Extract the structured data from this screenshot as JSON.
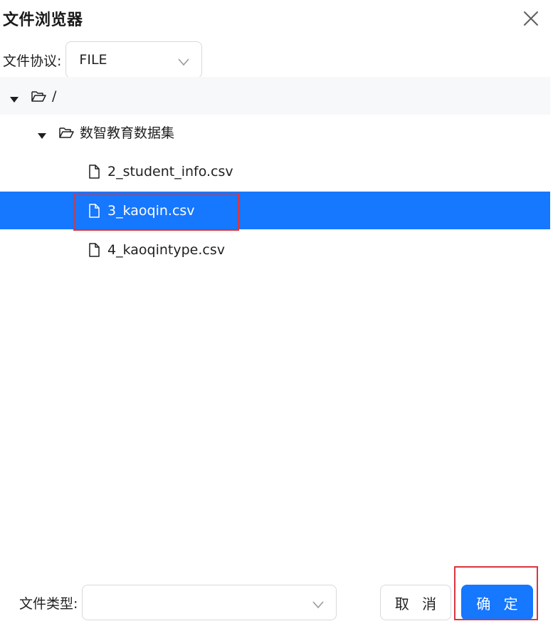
{
  "dialog": {
    "title": "文件浏览器"
  },
  "protocol": {
    "label": "文件协议",
    "value": "FILE"
  },
  "tree": {
    "root": {
      "label": "/"
    },
    "folder": {
      "label": "数智教育数据集"
    },
    "files": [
      {
        "label": "2_student_info.csv",
        "selected": false
      },
      {
        "label": "3_kaoqin.csv",
        "selected": true
      },
      {
        "label": "4_kaoqintype.csv",
        "selected": false
      }
    ]
  },
  "footer": {
    "file_type_label": "文件类型",
    "file_type_value": "",
    "cancel_label": "取 消",
    "ok_label": "确 定"
  },
  "colors": {
    "accent": "#1677ff",
    "highlight_border": "#d9363e",
    "root_row_bg": "#f7f8fa"
  },
  "icons": {
    "close": "close-icon",
    "dropdown": "chevron-down-icon",
    "expand": "caret-down-icon",
    "folder": "folder-open-icon",
    "file": "file-icon"
  }
}
